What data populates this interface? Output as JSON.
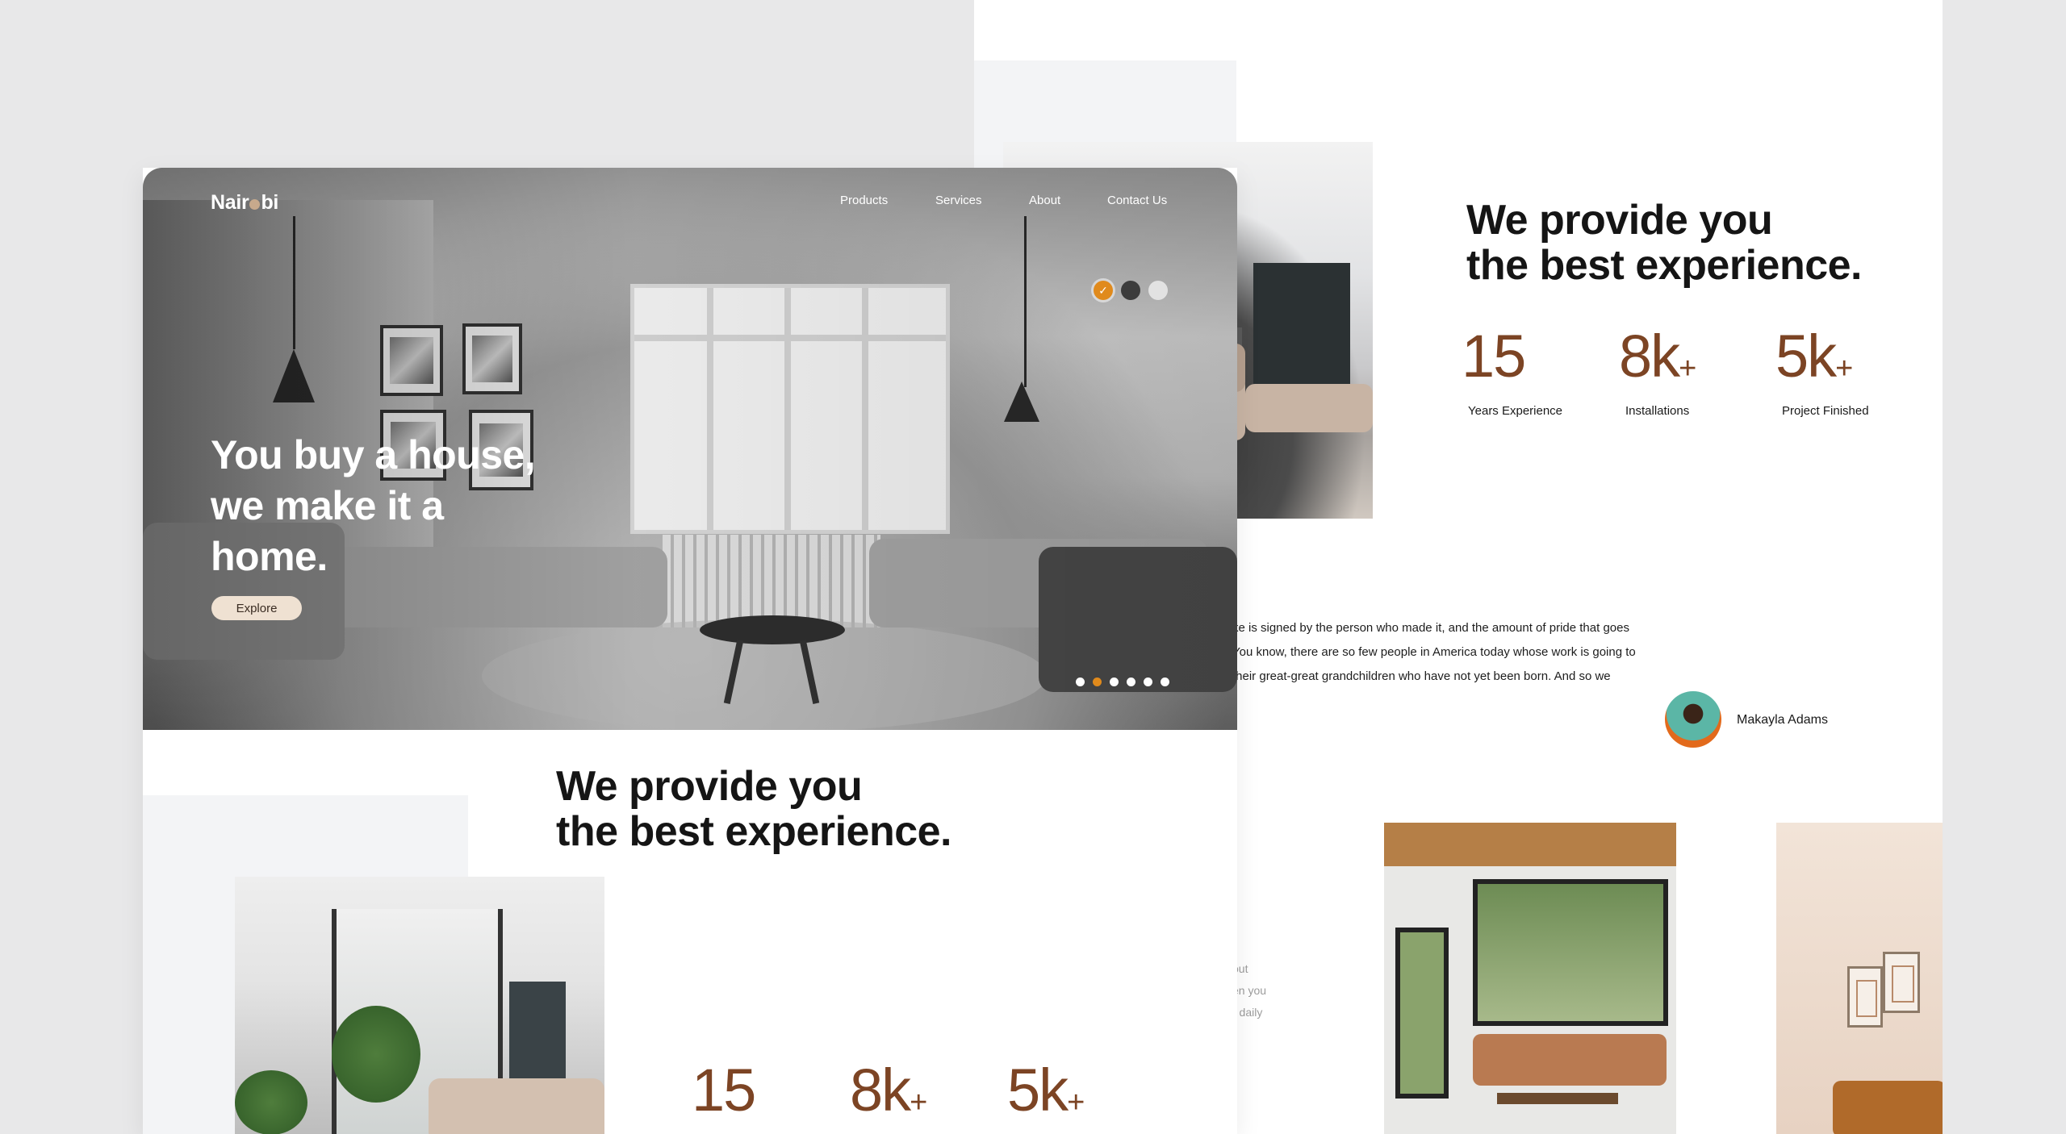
{
  "brand": {
    "name_left": "Nair",
    "name_right": "bi"
  },
  "nav": [
    "Products",
    "Services",
    "About",
    "Contact Us"
  ],
  "hero": {
    "headline_lines": [
      "You buy a house,",
      "we make it a",
      "home."
    ],
    "cta_label": "Explore",
    "check_mark": "✓"
  },
  "experience": {
    "headline_lines": [
      "We provide you",
      "the best experience."
    ],
    "stats": [
      {
        "value": "15",
        "suffix": "",
        "label": "Years Experience"
      },
      {
        "value": "8k",
        "suffix": "+",
        "label": "Installations"
      },
      {
        "value": "5k",
        "suffix": "+",
        "label": "Project Finished"
      }
    ]
  },
  "testimonial": {
    "lines": [
      "ke is signed by the person who made it, and the amount of pride that goes",
      "You know, there are so few people in America today whose work is going to",
      "their great-great grandchildren who have not yet been born. And so we"
    ],
    "author": "Makayla Adams"
  },
  "faded_text": [
    "out",
    "en you",
    "r daily"
  ],
  "colors": {
    "accent": "#e08a1c",
    "stat_brown": "#7c4424",
    "cta_bg": "#efe1d2"
  }
}
